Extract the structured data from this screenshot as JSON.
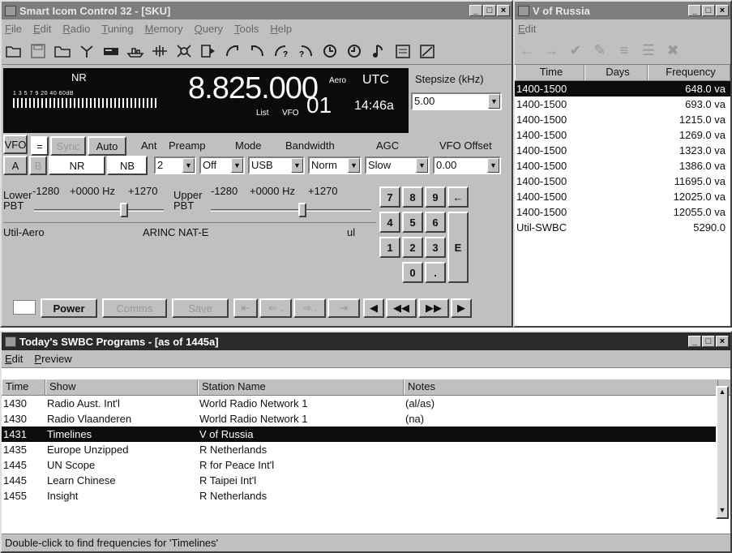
{
  "main": {
    "title": "Smart Icom Control 32 - [SKU]",
    "menu": [
      "File",
      "Edit",
      "Radio",
      "Tuning",
      "Memory",
      "Query",
      "Tools",
      "Help"
    ],
    "nr_label": "NR",
    "frequency": "8.825.000",
    "aero": "Aero",
    "utc": "UTC",
    "list": "List",
    "vfo": "VFO",
    "vfo_num": "01",
    "time": "14:46a",
    "stepsize_label": "Stepsize (kHz)",
    "stepsize": "5.00",
    "meter_scale": "1  3  5  7  9  20  40  60dB",
    "btn_vfo": "VFO",
    "btn_eq": "=",
    "btn_sync": "Sync",
    "btn_auto": "Auto",
    "lbl_ant": "Ant",
    "lbl_preamp": "Preamp",
    "lbl_mode": "Mode",
    "lbl_bandwidth": "Bandwidth",
    "lbl_agc": "AGC",
    "lbl_vfo_offset": "VFO Offset",
    "btn_a": "A",
    "btn_b": "B",
    "btn_nr": "NR",
    "btn_nb": "NB",
    "ant_value": "2",
    "preamp_value": "Off",
    "mode_value": "USB",
    "bandwidth_value": "Norm",
    "agc_value": "Slow",
    "offset_value": "0.00",
    "lower_pbt": "Lower\nPBT",
    "upper_pbt": "Upper\nPBT",
    "pbt_min": "-1280",
    "pbt_mid": "+0000 Hz",
    "pbt_max": "+1270",
    "info_station": "Util-Aero",
    "info_name": "ARINC NAT-E",
    "info_lang": "ul",
    "keys": [
      "7",
      "8",
      "9",
      "←",
      "4",
      "5",
      "6",
      "1",
      "2",
      "3",
      "E",
      "0",
      "."
    ],
    "btn_power": "Power",
    "btn_comms": "Comms",
    "btn_save": "Save"
  },
  "freq_window": {
    "title": "V of Russia",
    "menu": [
      "Edit"
    ],
    "columns": [
      "Time",
      "Days",
      "Frequency"
    ],
    "rows": [
      {
        "time": "1400-1500",
        "days": "",
        "freq": "648.0 va",
        "selected": true
      },
      {
        "time": "1400-1500",
        "days": "",
        "freq": "693.0 va"
      },
      {
        "time": "1400-1500",
        "days": "",
        "freq": "1215.0 va"
      },
      {
        "time": "1400-1500",
        "days": "",
        "freq": "1269.0 va"
      },
      {
        "time": "1400-1500",
        "days": "",
        "freq": "1323.0 va"
      },
      {
        "time": "1400-1500",
        "days": "",
        "freq": "1386.0 va"
      },
      {
        "time": "1400-1500",
        "days": "",
        "freq": "11695.0 va"
      },
      {
        "time": "1400-1500",
        "days": "",
        "freq": "12025.0 va"
      },
      {
        "time": "1400-1500",
        "days": "",
        "freq": "12055.0 va"
      },
      {
        "time": "Util-SWBC",
        "days": "",
        "freq": "5290.0"
      }
    ]
  },
  "programs": {
    "title": "Today's SWBC Programs - [as of 1445a]",
    "menu": [
      "Edit",
      "Preview"
    ],
    "columns": [
      "Time",
      "Show",
      "Station Name",
      "Notes"
    ],
    "rows": [
      {
        "time": "1430",
        "show": "Radio Aust. Int'l",
        "station": "World Radio Network 1",
        "notes": "(al/as)"
      },
      {
        "time": "1430",
        "show": "Radio Vlaanderen",
        "station": "World Radio Network 1",
        "notes": "(na)"
      },
      {
        "time": "1431",
        "show": "Timelines",
        "station": "V of Russia",
        "notes": "",
        "selected": true
      },
      {
        "time": "1435",
        "show": "Europe Unzipped",
        "station": "R Netherlands",
        "notes": ""
      },
      {
        "time": "1445",
        "show": "UN Scope",
        "station": "R for Peace Int'l",
        "notes": ""
      },
      {
        "time": "1445",
        "show": "Learn Chinese",
        "station": "R Taipei Int'l",
        "notes": ""
      },
      {
        "time": "1455",
        "show": "Insight",
        "station": "R Netherlands",
        "notes": ""
      }
    ],
    "status": "Double-click to find frequencies for 'Timelines'"
  }
}
